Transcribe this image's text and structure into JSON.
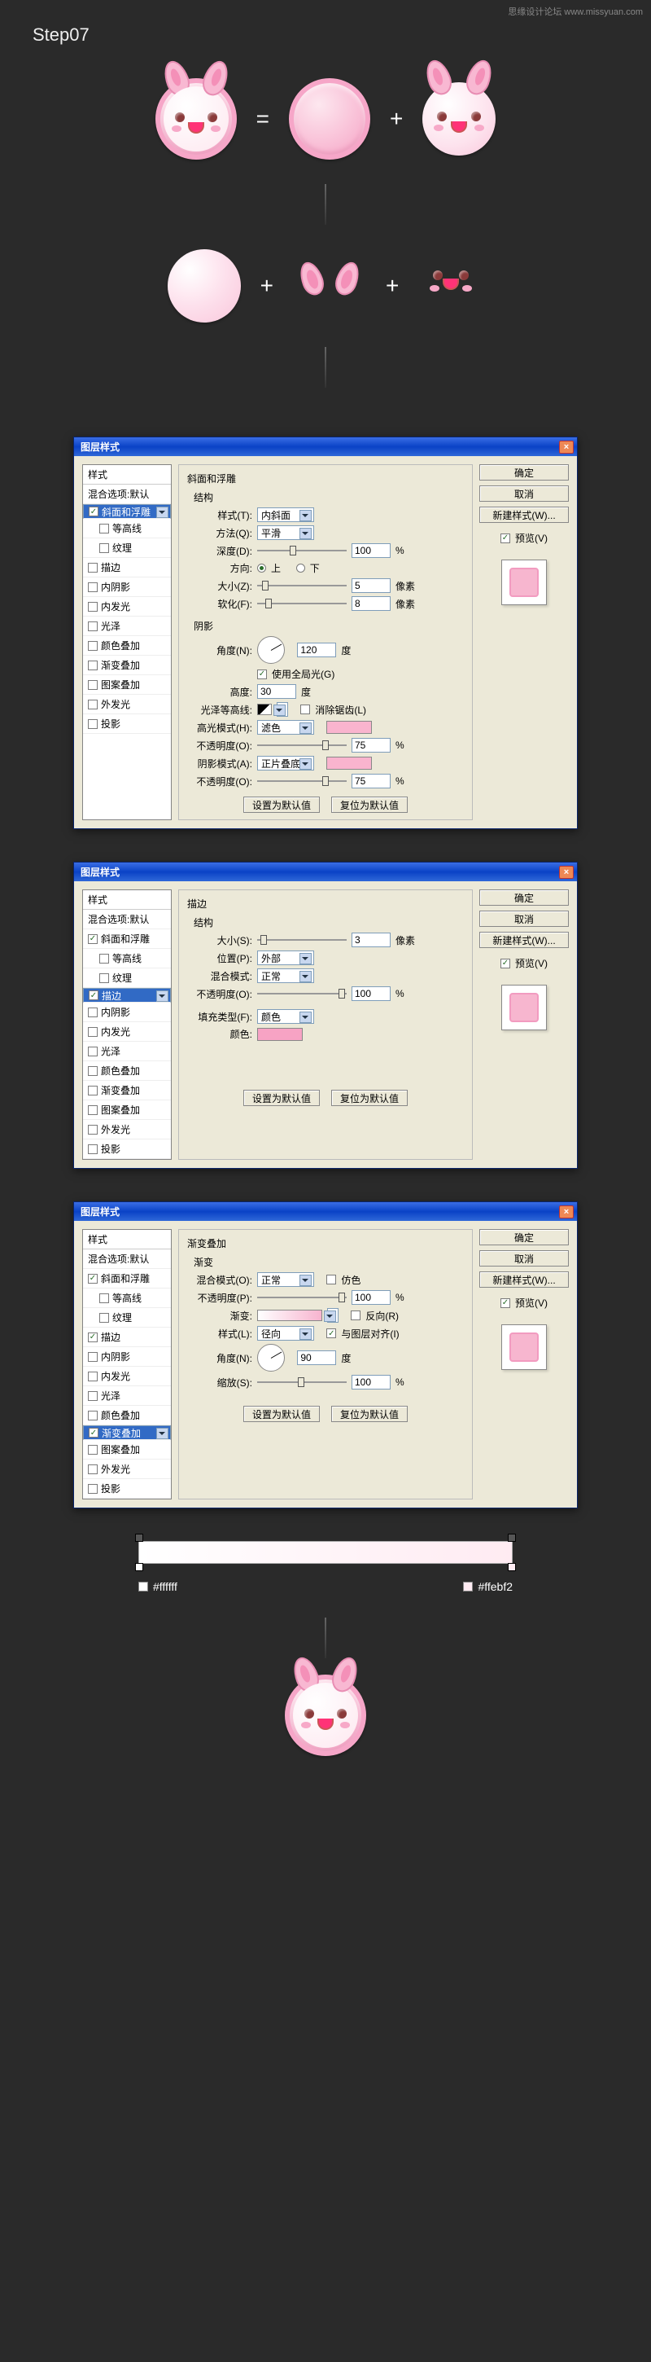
{
  "watermark": "思缘设计论坛  www.missyuan.com",
  "step_title": "Step07",
  "operators": {
    "eq": "=",
    "plus": "+"
  },
  "dialog_title": "图层样式",
  "rightcol": {
    "ok": "确定",
    "cancel": "取消",
    "newstyle": "新建样式(W)...",
    "preview": "预览(V)"
  },
  "btns": {
    "default": "设置为默认值",
    "reset": "复位为默认值"
  },
  "stylelist": {
    "hdr_styles": "样式",
    "hdr_blend": "混合选项:默认",
    "bevel": "斜面和浮雕",
    "contour": "等高线",
    "texture": "纹理",
    "stroke": "描边",
    "innershadow": "内阴影",
    "innerglow": "内发光",
    "satin": "光泽",
    "coloroverlay": "颜色叠加",
    "gradoverlay": "渐变叠加",
    "patternoverlay": "图案叠加",
    "outerglow": "外发光",
    "dropshadow": "投影"
  },
  "bevel": {
    "panel_title": "斜面和浮雕",
    "grp_struct": "结构",
    "style_l": "样式(T):",
    "style_v": "内斜面",
    "tech_l": "方法(Q):",
    "tech_v": "平滑",
    "depth_l": "深度(D):",
    "depth_v": "100",
    "pct": "%",
    "dir_l": "方向:",
    "dir_up": "上",
    "dir_down": "下",
    "size_l": "大小(Z):",
    "size_v": "5",
    "px": "像素",
    "soften_l": "软化(F):",
    "soften_v": "8",
    "grp_shade": "阴影",
    "angle_l": "角度(N):",
    "angle_v": "120",
    "deg": "度",
    "global": "使用全局光(G)",
    "alt_l": "高度:",
    "alt_v": "30",
    "gloss_l": "光泽等高线:",
    "anti": "消除锯齿(L)",
    "hi_mode_l": "高光模式(H):",
    "hi_mode_v": "滤色",
    "opac_l": "不透明度(O):",
    "hi_opac_v": "75",
    "sh_mode_l": "阴影模式(A):",
    "sh_mode_v": "正片叠底",
    "sh_opac_v": "75"
  },
  "stroke": {
    "panel_title": "描边",
    "grp": "结构",
    "size_l": "大小(S):",
    "size_v": "3",
    "px": "像素",
    "pos_l": "位置(P):",
    "pos_v": "外部",
    "blend_l": "混合模式:",
    "blend_v": "正常",
    "opac_l": "不透明度(O):",
    "opac_v": "100",
    "pct": "%",
    "fill_l": "填充类型(F):",
    "fill_v": "颜色",
    "color_l": "颜色:"
  },
  "grad": {
    "panel_title": "渐变叠加",
    "grp": "渐变",
    "blend_l": "混合模式(O):",
    "blend_v": "正常",
    "dither": "仿色",
    "opac_l": "不透明度(P):",
    "opac_v": "100",
    "pct": "%",
    "grad_l": "渐变:",
    "reverse": "反向(R)",
    "style_l": "样式(L):",
    "style_v": "径向",
    "align": "与图层对齐(I)",
    "angle_l": "角度(N):",
    "angle_v": "90",
    "deg": "度",
    "scale_l": "缩放(S):",
    "scale_v": "100"
  },
  "gradient_hex": {
    "left": "#ffffff",
    "right": "#ffebf2"
  }
}
